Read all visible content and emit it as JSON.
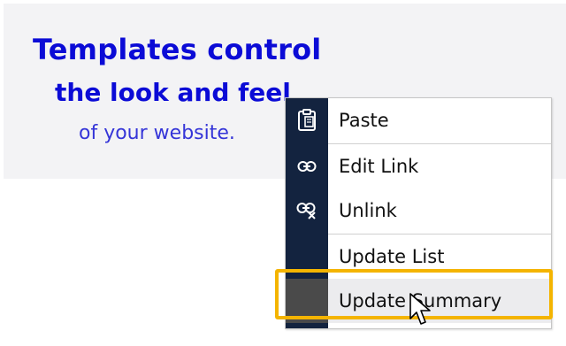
{
  "hero": {
    "line1": "Templates control",
    "line2": "the look and feel",
    "line3": "of your website.",
    "colors": {
      "heading": "#0b0bd6",
      "subtext": "#3535d8",
      "panel": "#f3f3f5"
    }
  },
  "context_menu": {
    "gutter_color": "#13233f",
    "items": [
      {
        "label": "Paste",
        "icon": "paste-icon"
      },
      {
        "label": "Edit Link",
        "icon": "link-icon"
      },
      {
        "label": "Unlink",
        "icon": "unlink-icon"
      },
      {
        "label": "Update List",
        "icon": ""
      },
      {
        "label": "Update Summary",
        "icon": "",
        "state": "hovered"
      }
    ]
  },
  "annotation": {
    "highlight_color": "#f4b400",
    "cursor": "pointer-cursor-icon"
  }
}
